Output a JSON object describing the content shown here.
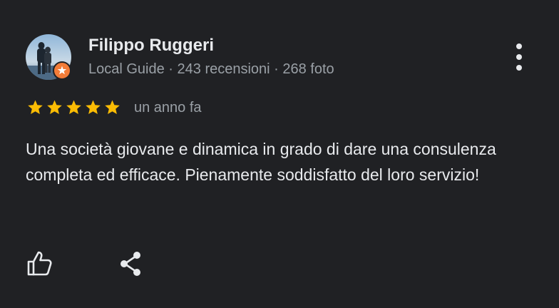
{
  "review": {
    "author_name": "Filippo Ruggeri",
    "author_meta": "Local Guide · 243 recensioni · 268 foto",
    "avatar_icon": "user-photo-avatar",
    "badge_icon": "local-guide-badge-icon",
    "rating": 5,
    "rating_max": 5,
    "date": "un anno fa",
    "text": "Una società giovane e dinamica in grado di dare una consulenza completa ed efficace. Pienamente soddisfatto del loro servizio!",
    "menu_icon": "more-vert-icon",
    "like_icon": "thumb-up-icon",
    "share_icon": "share-icon"
  },
  "colors": {
    "background": "#202124",
    "text_primary": "#e8eaed",
    "text_secondary": "#9aa0a6",
    "star": "#fbbc04",
    "badge": "#f37c38"
  }
}
